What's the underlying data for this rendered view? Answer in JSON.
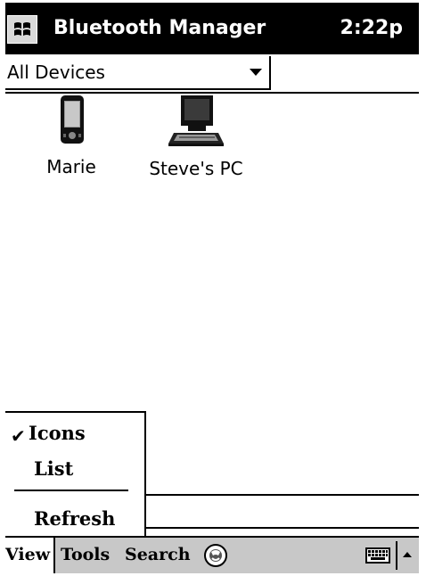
{
  "titlebar": {
    "title": "Bluetooth Manager",
    "clock": "2:22p",
    "start_icon": "windows-flag-icon"
  },
  "devices_filter": {
    "selected": "All Devices"
  },
  "devices": [
    {
      "label": "Marie",
      "icon": "pda-icon"
    },
    {
      "label": "Steve's PC",
      "icon": "computer-icon"
    }
  ],
  "view_menu": {
    "items": [
      {
        "label": "Icons",
        "checked": true
      },
      {
        "label": "List",
        "checked": false
      },
      {
        "label": "Refresh",
        "checked": false
      }
    ],
    "check_glyph": "✔"
  },
  "menubar": {
    "items": [
      "View",
      "Tools",
      "Search"
    ],
    "globe_icon": "globe-icon",
    "keyboard_icon": "keyboard-icon"
  }
}
